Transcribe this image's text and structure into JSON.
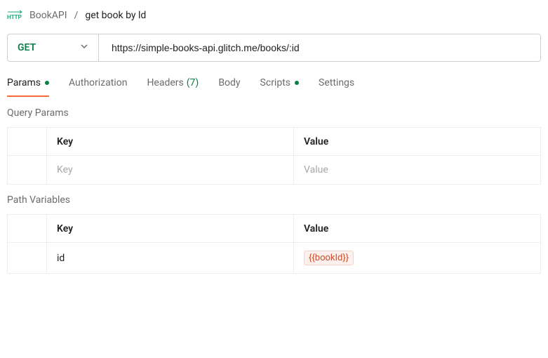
{
  "breadcrumb": {
    "parent": "BookAPI",
    "current": "get book by ld"
  },
  "request": {
    "method": "GET",
    "url": "https://simple-books-api.glitch.me/books/:id"
  },
  "tabs": {
    "params": "Params",
    "authorization": "Authorization",
    "headers_label": "Headers",
    "headers_count": "(7)",
    "body": "Body",
    "scripts": "Scripts",
    "settings": "Settings"
  },
  "queryParams": {
    "title": "Query Params",
    "header_key": "Key",
    "header_value": "Value",
    "placeholder_key": "Key",
    "placeholder_value": "Value"
  },
  "pathVariables": {
    "title": "Path Variables",
    "header_key": "Key",
    "header_value": "Value",
    "rows": [
      {
        "key": "id",
        "value": "{{bookId}}"
      }
    ]
  }
}
